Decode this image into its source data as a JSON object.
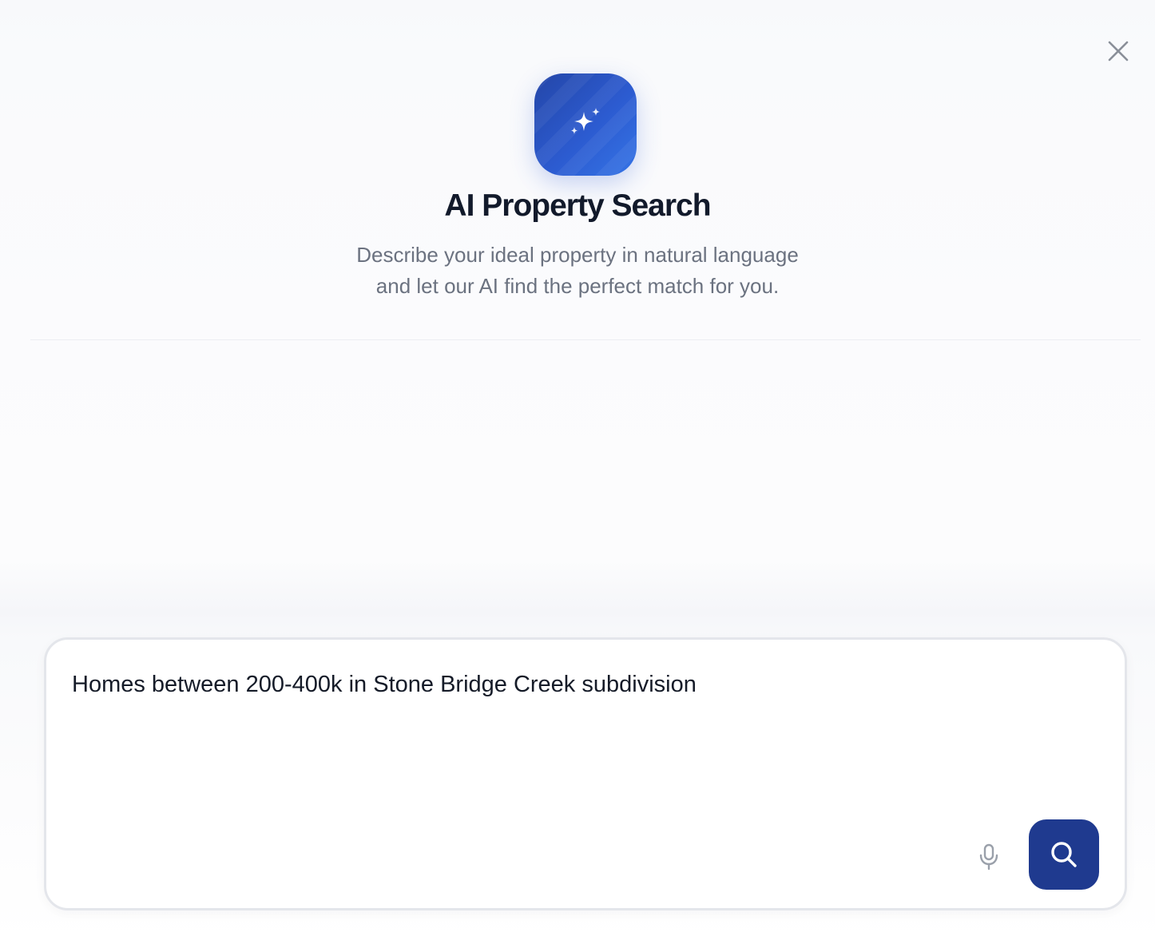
{
  "header": {
    "close_icon": "close-icon",
    "logo_icon": "sparkles-icon",
    "title": "AI Property Search",
    "subtitle_lines": [
      "Describe your ideal property in natural language",
      "and let our AI find the perfect match for you."
    ]
  },
  "search": {
    "query_value": "Homes between 200-400k in Stone Bridge Creek subdivision",
    "mic_icon": "microphone-icon",
    "submit_icon": "search-icon"
  },
  "colors": {
    "brand_primary": "#1f3a8f",
    "logo_gradient_start": "#2446a8",
    "logo_gradient_end": "#3574e6",
    "title_text": "#121a2b",
    "muted_text": "#6b7280"
  }
}
